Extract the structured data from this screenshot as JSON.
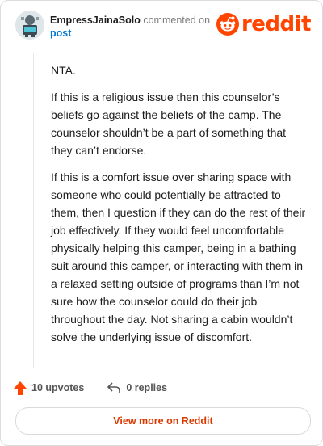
{
  "comment": {
    "author": "EmpressJainaSolo",
    "action": "commented on",
    "target": "post",
    "paragraphs": [
      "NTA.",
      "If this is a religious issue then this counselor’s beliefs go against the beliefs of the camp. The counselor shouldn’t be a part of something that they can’t endorse.",
      "If this is a comfort issue over sharing space with someone who could potentially be attracted to them, then I question if they can do the rest of their job effectively. If they would feel uncomfortable physically helping this camper, being in a bathing suit around this camper, or interacting with them in a relaxed setting outside of programs than I’m not sure how the counselor could do their job throughout the day. Not sharing a cabin wouldn’t solve the underlying issue of discomfort."
    ]
  },
  "brand": {
    "name": "reddit",
    "color": "#ff4500"
  },
  "actions": {
    "upvotes": "10 upvotes",
    "replies": "0 replies",
    "upvote_icon": "upvote-arrow-icon",
    "reply_icon": "reply-arrow-icon"
  },
  "footer": {
    "view_more": "View more on Reddit"
  },
  "colors": {
    "link": "#0079d3",
    "accent": "#ff4500",
    "cta": "#d93a00"
  }
}
